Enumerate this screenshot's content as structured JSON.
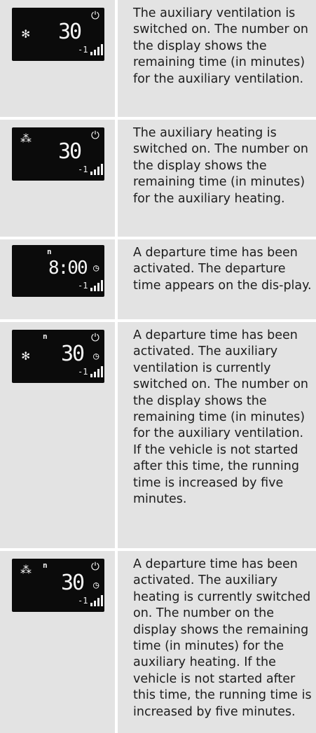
{
  "rows": [
    {
      "text": "The auxiliary ventilation is switched on. The number on the display shows the remaining time (in minutes) for the auxiliary ventilation.",
      "display": {
        "value": "30",
        "sub": "-1",
        "icons": [
          "fan-icon",
          "timer-icon",
          "signal-icon"
        ]
      }
    },
    {
      "text": "The auxiliary heating is switched on. The number on the display shows the remaining time (in minutes) for the auxiliary heating.",
      "display": {
        "value": "30",
        "sub": "-1",
        "icons": [
          "heating-icon",
          "timer-icon",
          "signal-icon"
        ]
      }
    },
    {
      "text": "A departure time has been activated. The departure time appears on the dis-play.",
      "display": {
        "value": "8:00",
        "sub": "-1",
        "icons": [
          "departure-marker-icon",
          "clock-icon",
          "signal-icon"
        ]
      }
    },
    {
      "text": "A departure time has been activated. The auxiliary ventilation is currently switched on. The number on the display shows the remaining time (in minutes) for the auxiliary ventilation. If the vehicle is not started after this time, the running time is increased by five minutes.",
      "display": {
        "value": "30",
        "sub": "-1",
        "icons": [
          "fan-icon",
          "departure-marker-icon",
          "timer-icon",
          "clock-icon",
          "signal-icon"
        ]
      }
    },
    {
      "text": "A departure time has been activated. The auxiliary heating is currently switched on. The number on the display shows the remaining time (in minutes) for the auxiliary heating. If the vehicle is not started after this time, the running time is increased by five minutes.",
      "display": {
        "value": "30",
        "sub": "-1",
        "icons": [
          "heating-icon",
          "departure-marker-icon",
          "timer-icon",
          "clock-icon",
          "signal-icon"
        ]
      }
    }
  ]
}
